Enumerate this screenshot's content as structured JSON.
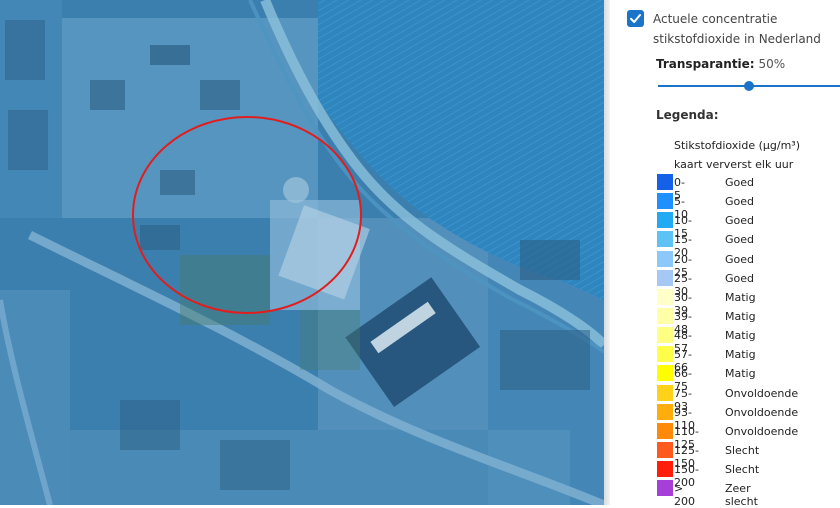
{
  "layer": {
    "checked": true,
    "title": "Actuele concentratie stikstofdioxide in Nederland"
  },
  "transparency": {
    "label": "Transparantie:",
    "value": "50%",
    "level": 0.5
  },
  "legend": {
    "heading": "Legenda:",
    "unit_line": "Stikstofdioxide (µg/m³)",
    "refresh_line": "kaart ververst elk uur",
    "items": [
      {
        "range": "0-5",
        "quality": "Goed",
        "color": "#1560e8"
      },
      {
        "range": "5-10",
        "quality": "Goed",
        "color": "#1e90ff"
      },
      {
        "range": "10-15",
        "quality": "Goed",
        "color": "#22aaf2"
      },
      {
        "range": "15-20",
        "quality": "Goed",
        "color": "#5ec2f5"
      },
      {
        "range": "20-25",
        "quality": "Goed",
        "color": "#8cc9fa"
      },
      {
        "range": "25-30",
        "quality": "Goed",
        "color": "#a6c8f5"
      },
      {
        "range": "30-39",
        "quality": "Matig",
        "color": "#ffffc8"
      },
      {
        "range": "39-48",
        "quality": "Matig",
        "color": "#ffffa8"
      },
      {
        "range": "48-57",
        "quality": "Matig",
        "color": "#ffff82"
      },
      {
        "range": "57-66",
        "quality": "Matig",
        "color": "#ffff4a"
      },
      {
        "range": "66-75",
        "quality": "Matig",
        "color": "#ffff00"
      },
      {
        "range": "75-93",
        "quality": "Onvoldoende",
        "color": "#ffd21a"
      },
      {
        "range": "93-110",
        "quality": "Onvoldoende",
        "color": "#ffad0a"
      },
      {
        "range": "110-125",
        "quality": "Onvoldoende",
        "color": "#ff8a0a"
      },
      {
        "range": "125-150",
        "quality": "Slecht",
        "color": "#ff5a1e"
      },
      {
        "range": "150-200",
        "quality": "Slecht",
        "color": "#ff1e0a"
      },
      {
        "range": "> 200",
        "quality": "Zeer slecht",
        "color": "#a63ed8"
      }
    ]
  },
  "colors": {
    "accent": "#1c74c8",
    "highlight_circle": "#e01e1e",
    "map_overlay": "#3a82b6"
  }
}
